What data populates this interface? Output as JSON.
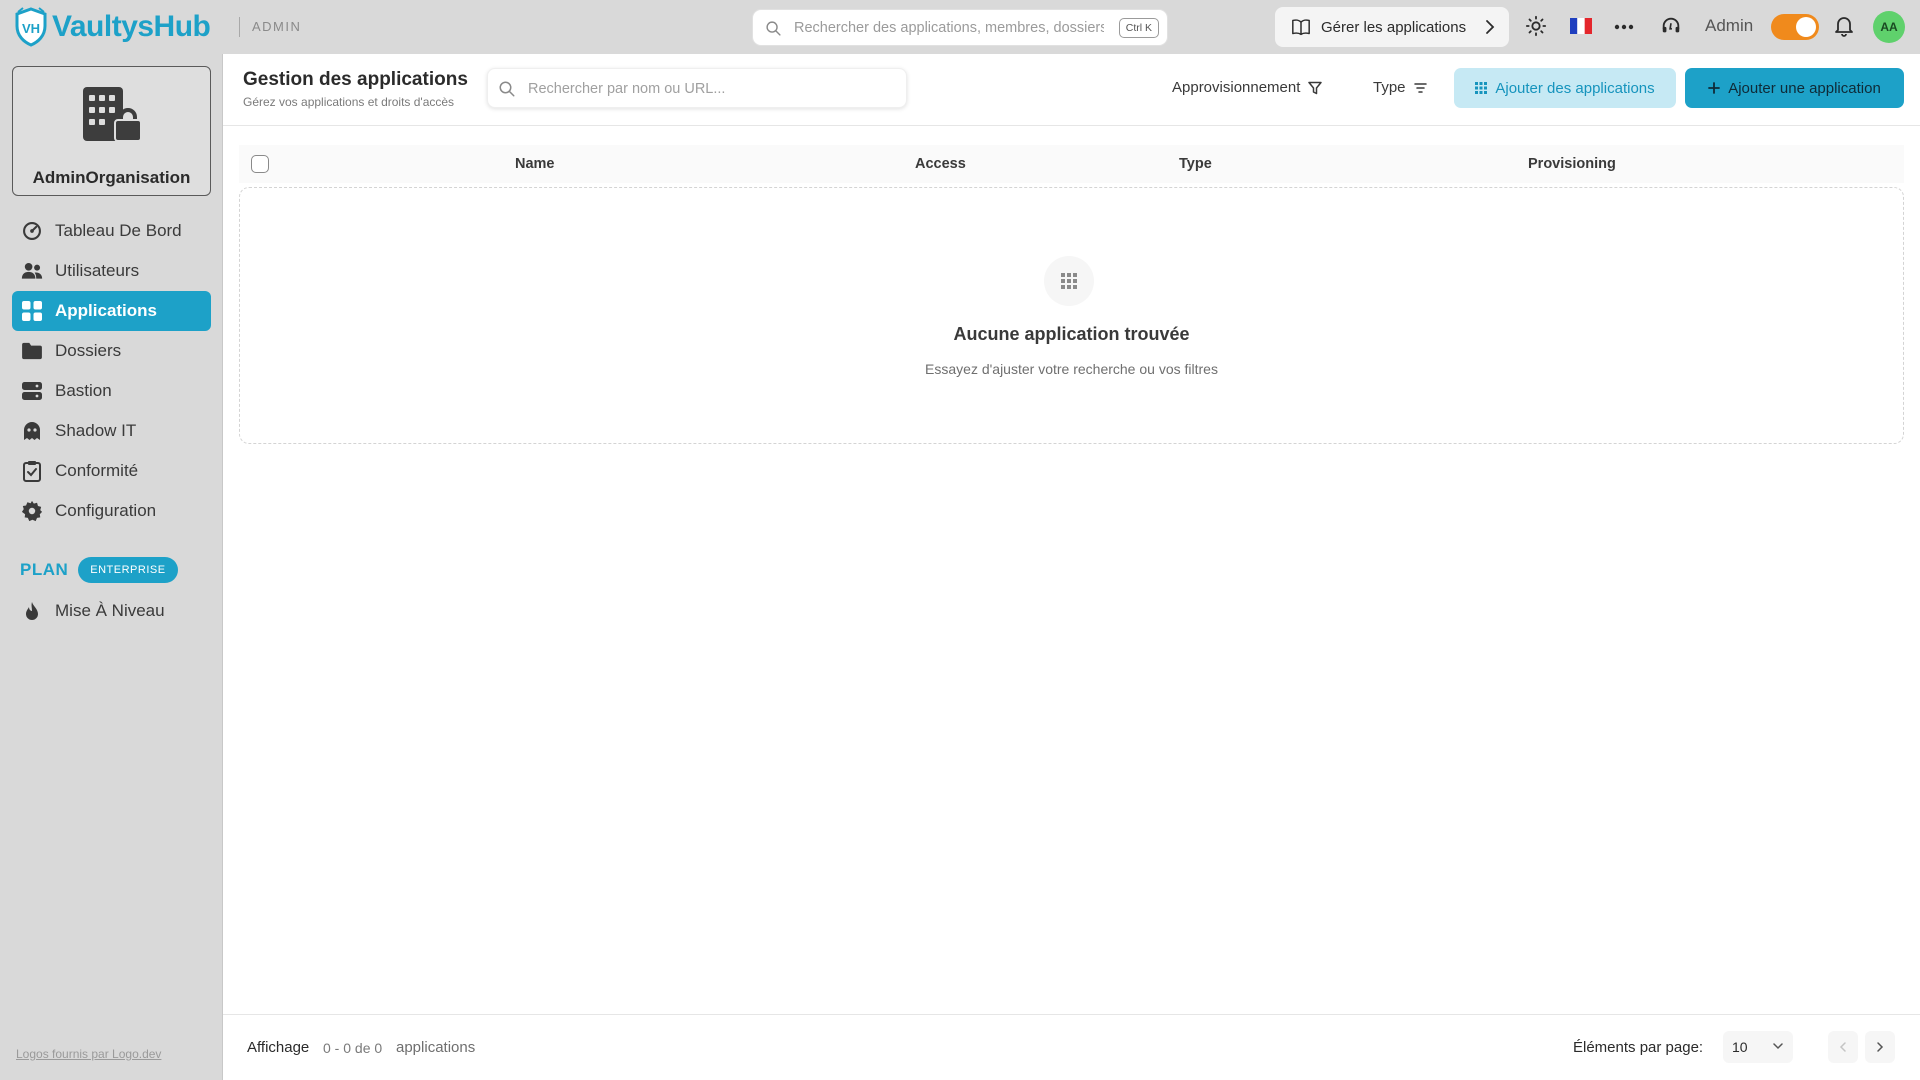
{
  "brand": {
    "name": "VaultysHub",
    "mark": "VH",
    "color": "#1da1c8"
  },
  "topbar": {
    "mode_tag": "ADMIN",
    "search_placeholder": "Rechercher des applications, membres, dossiers...",
    "search_shortcut": "Ctrl K",
    "manage_apps_label": "Gérer les applications",
    "role_label": "Admin",
    "avatar_initials": "AA",
    "toggle_on": true
  },
  "sidebar": {
    "org_name": "AdminOrganisation",
    "items": [
      {
        "label": "Tableau De Bord",
        "icon": "dashboard-gauge-icon",
        "active": false
      },
      {
        "label": "Utilisateurs",
        "icon": "users-icon",
        "active": false
      },
      {
        "label": "Applications",
        "icon": "apps-grid-icon",
        "active": true
      },
      {
        "label": "Dossiers",
        "icon": "folder-icon",
        "active": false
      },
      {
        "label": "Bastion",
        "icon": "server-icon",
        "active": false
      },
      {
        "label": "Shadow IT",
        "icon": "ghost-icon",
        "active": false
      },
      {
        "label": "Conformité",
        "icon": "clipboard-check-icon",
        "active": false
      },
      {
        "label": "Configuration",
        "icon": "gear-icon",
        "active": false
      }
    ],
    "plan_label": "PLAN",
    "plan_badge": "ENTERPRISE",
    "upgrade_label": "Mise À Niveau",
    "footer_link": "Logos fournis par Logo.dev"
  },
  "main": {
    "title": "Gestion des applications",
    "subtitle": "Gérez vos applications et droits d'accès",
    "search_placeholder": "Rechercher par nom ou URL...",
    "filter_provisioning": "Approvisionnement",
    "filter_type": "Type",
    "add_apps_label": "Ajouter des applications",
    "add_app_label": "Ajouter une application"
  },
  "table": {
    "columns": [
      "Name",
      "Access",
      "Type",
      "Provisioning"
    ],
    "empty_title": "Aucune application trouvée",
    "empty_subtitle": "Essayez d'ajuster votre recherche ou vos filtres"
  },
  "footer": {
    "showing_label": "Affichage",
    "range": "0 - 0 de 0",
    "unit": "applications",
    "per_page_label": "Éléments par page:",
    "per_page_value": "10"
  }
}
